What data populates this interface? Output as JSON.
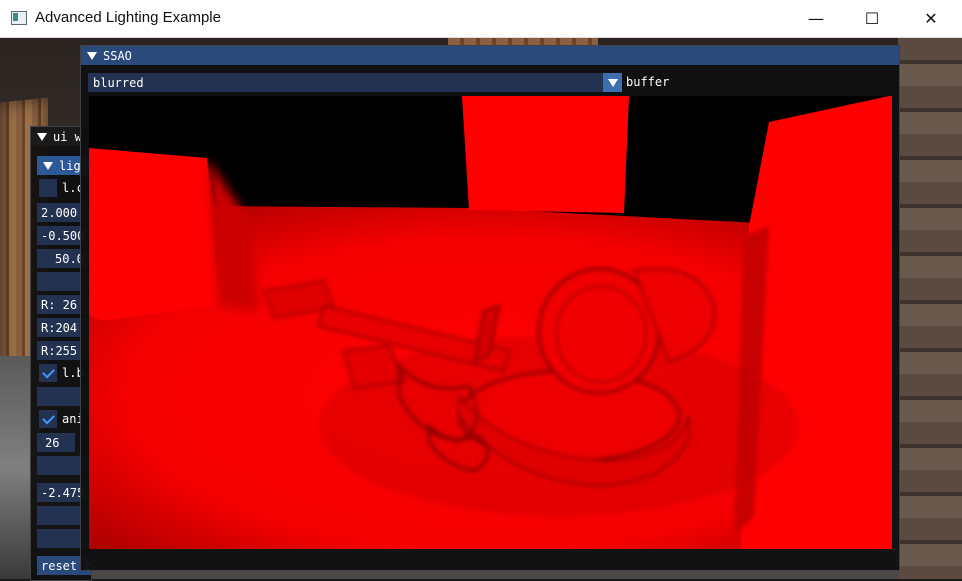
{
  "window": {
    "title": "Advanced Lighting Example",
    "minimize_glyph": "—",
    "maximize_glyph": "☐",
    "close_glyph": "✕"
  },
  "ui_window": {
    "title": "ui w",
    "tree_node": "lig",
    "rows": [
      {
        "text": "l.c",
        "checkbox": "off"
      },
      {
        "text": "2.000"
      },
      {
        "text": "-0.500"
      },
      {
        "text": "50.0"
      },
      {
        "text": ""
      },
      {
        "text": "R: 26"
      },
      {
        "text": "R:204"
      },
      {
        "text": "R:255"
      },
      {
        "text": "l.b",
        "checkbox": "on"
      },
      {
        "text": ""
      },
      {
        "text": "ani",
        "checkbox": "on"
      },
      {
        "text": "26"
      },
      {
        "text": ""
      },
      {
        "text": "-2.475"
      },
      {
        "text": ""
      },
      {
        "text": ""
      },
      {
        "text": "reset camera"
      }
    ]
  },
  "ssao_window": {
    "title": "SSAO",
    "combo_value": "blurred",
    "combo_label": "buffer",
    "ssao_color": "#ff0000"
  }
}
